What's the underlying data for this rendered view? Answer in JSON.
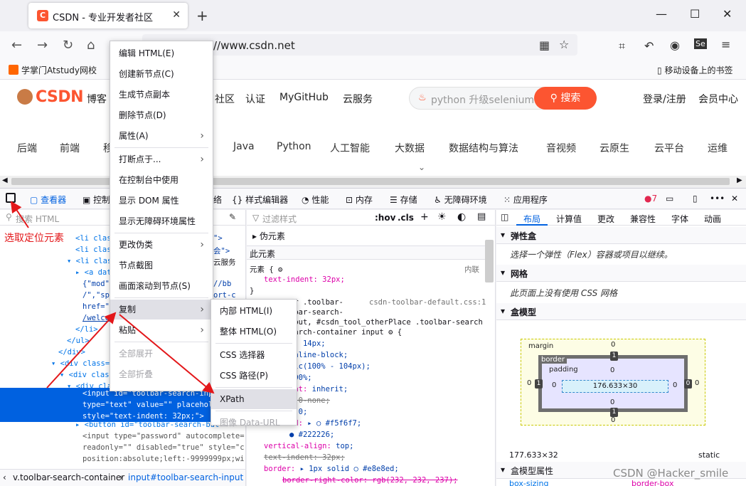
{
  "browser": {
    "tab_title": "CSDN - 专业开发者社区",
    "tab_icon": "C",
    "url": "//www.csdn.net",
    "bookmark_left": "学掌门Atstudy网校",
    "bookmark_right": "移动设备上的书签"
  },
  "site": {
    "logo": "CSDN",
    "topnav": [
      "博客",
      "社区",
      "认证",
      "MyGitHub",
      "云服务"
    ],
    "search_placeholder": "python 升级selenium",
    "search_button": "搜索",
    "login": "登录/注册",
    "member": "会员中心",
    "categories": [
      "后端",
      "前端",
      "移",
      "Java",
      "Python",
      "人工智能",
      "大数据",
      "数据结构与算法",
      "音视频",
      "云原生",
      "云平台",
      "运维"
    ]
  },
  "devtools": {
    "tabs": [
      "查看器",
      "控制",
      "络",
      "样式编辑器",
      "性能",
      "内存",
      "存储",
      "无障碍环境",
      "应用程序"
    ],
    "error_count": "7",
    "html_search": "搜索 HTML",
    "rules_filter": "过滤样式",
    "hov": ":hov",
    "cls": ".cls",
    "layout_tabs": [
      "布局",
      "计算值",
      "更改",
      "兼容性",
      "字体",
      "动画"
    ],
    "flex_title": "弹性盒",
    "flex_note": "选择一个弹性（Flex）容器或项目以继续。",
    "grid_title": "网格",
    "grid_note": "此页面上没有使用 CSS 网格",
    "boxmodel_title": "盒模型",
    "boxmodel_props_title": "盒模型属性",
    "boxmodel": {
      "margin_label": "margin",
      "border_label": "border",
      "padding_label": "padding",
      "content_size": "176.633×30",
      "size_readout": "177.633×32",
      "position": "static",
      "zero": "0",
      "one": "1"
    },
    "box_sizing_prop": "box-sizing",
    "box_sizing_val": "border-box",
    "pseudo_elements": "伪元素",
    "this_element": "此元素",
    "element_label": "元素",
    "inline_label": "内联",
    "text_indent_rule": "text-indent: 32px;",
    "css_source": "csdn-toolbar-default.css:1",
    "breadcrumb_1": "v.toolbar-search-container",
    "breadcrumb_2": "input#toolbar-search-input"
  },
  "context_menu": {
    "items": [
      {
        "label": "编辑 HTML(E)",
        "disabled": false
      },
      {
        "label": "创建新节点(C)",
        "disabled": false
      },
      {
        "label": "生成节点副本",
        "disabled": false
      },
      {
        "label": "删除节点(D)",
        "disabled": false
      },
      {
        "label": "属性(A)",
        "disabled": false,
        "submenu": true
      },
      {
        "label": "打断点于...",
        "disabled": false,
        "submenu": true
      },
      {
        "label": "在控制台中使用",
        "disabled": false
      },
      {
        "label": "显示 DOM 属性",
        "disabled": false
      },
      {
        "label": "显示无障碍环境属性",
        "disabled": false
      },
      {
        "label": "更改伪类",
        "disabled": false,
        "submenu": true
      },
      {
        "label": "节点截图",
        "disabled": false
      },
      {
        "label": "画面滚动到节点(S)",
        "disabled": false
      },
      {
        "label": "复制",
        "disabled": false,
        "submenu": true,
        "hover": true
      },
      {
        "label": "粘贴",
        "disabled": false,
        "submenu": true
      },
      {
        "label": "全部展开",
        "disabled": true
      },
      {
        "label": "全部折叠",
        "disabled": true
      }
    ]
  },
  "copy_submenu": {
    "items": [
      {
        "label": "内部 HTML(I)",
        "disabled": false
      },
      {
        "label": "整体 HTML(O)",
        "disabled": false
      },
      {
        "label": "CSS 选择器",
        "disabled": false
      },
      {
        "label": "CSS 路径(P)",
        "disabled": false
      },
      {
        "label": "XPath",
        "disabled": false,
        "hover": true
      },
      {
        "label": "图像 Data-URL",
        "disabled": true
      }
    ]
  },
  "annotation": "选取定位元素",
  "watermark": "CSDN @Hacker_smile",
  "colors": {
    "accent": "#0061e0",
    "brand": "#fc5531",
    "annotation": "#e3171a"
  }
}
